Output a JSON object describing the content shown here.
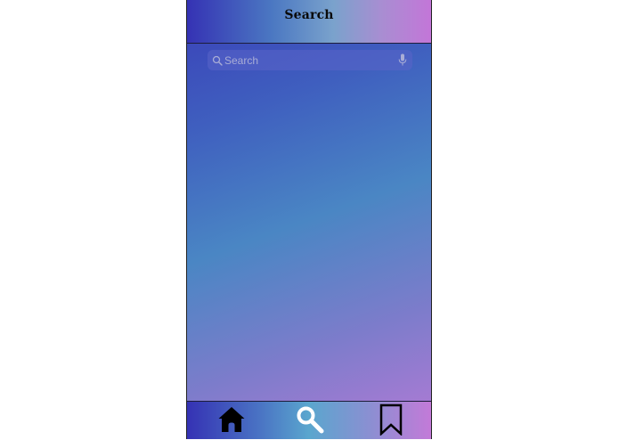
{
  "header": {
    "title": "Search"
  },
  "search": {
    "placeholder": "Search",
    "value": ""
  },
  "icons": {
    "search_field": "magnifier-icon",
    "voice": "microphone-icon",
    "tab_home": "home-icon",
    "tab_search": "search-icon",
    "tab_bookmark": "bookmark-icon"
  },
  "tabbar": {
    "active": "search"
  },
  "colors": {
    "gradient_start": "#3532b4",
    "gradient_mid": "#4a86c4",
    "gradient_end": "#c376d8",
    "icon_dark": "#000000",
    "icon_active": "#ffffff"
  }
}
